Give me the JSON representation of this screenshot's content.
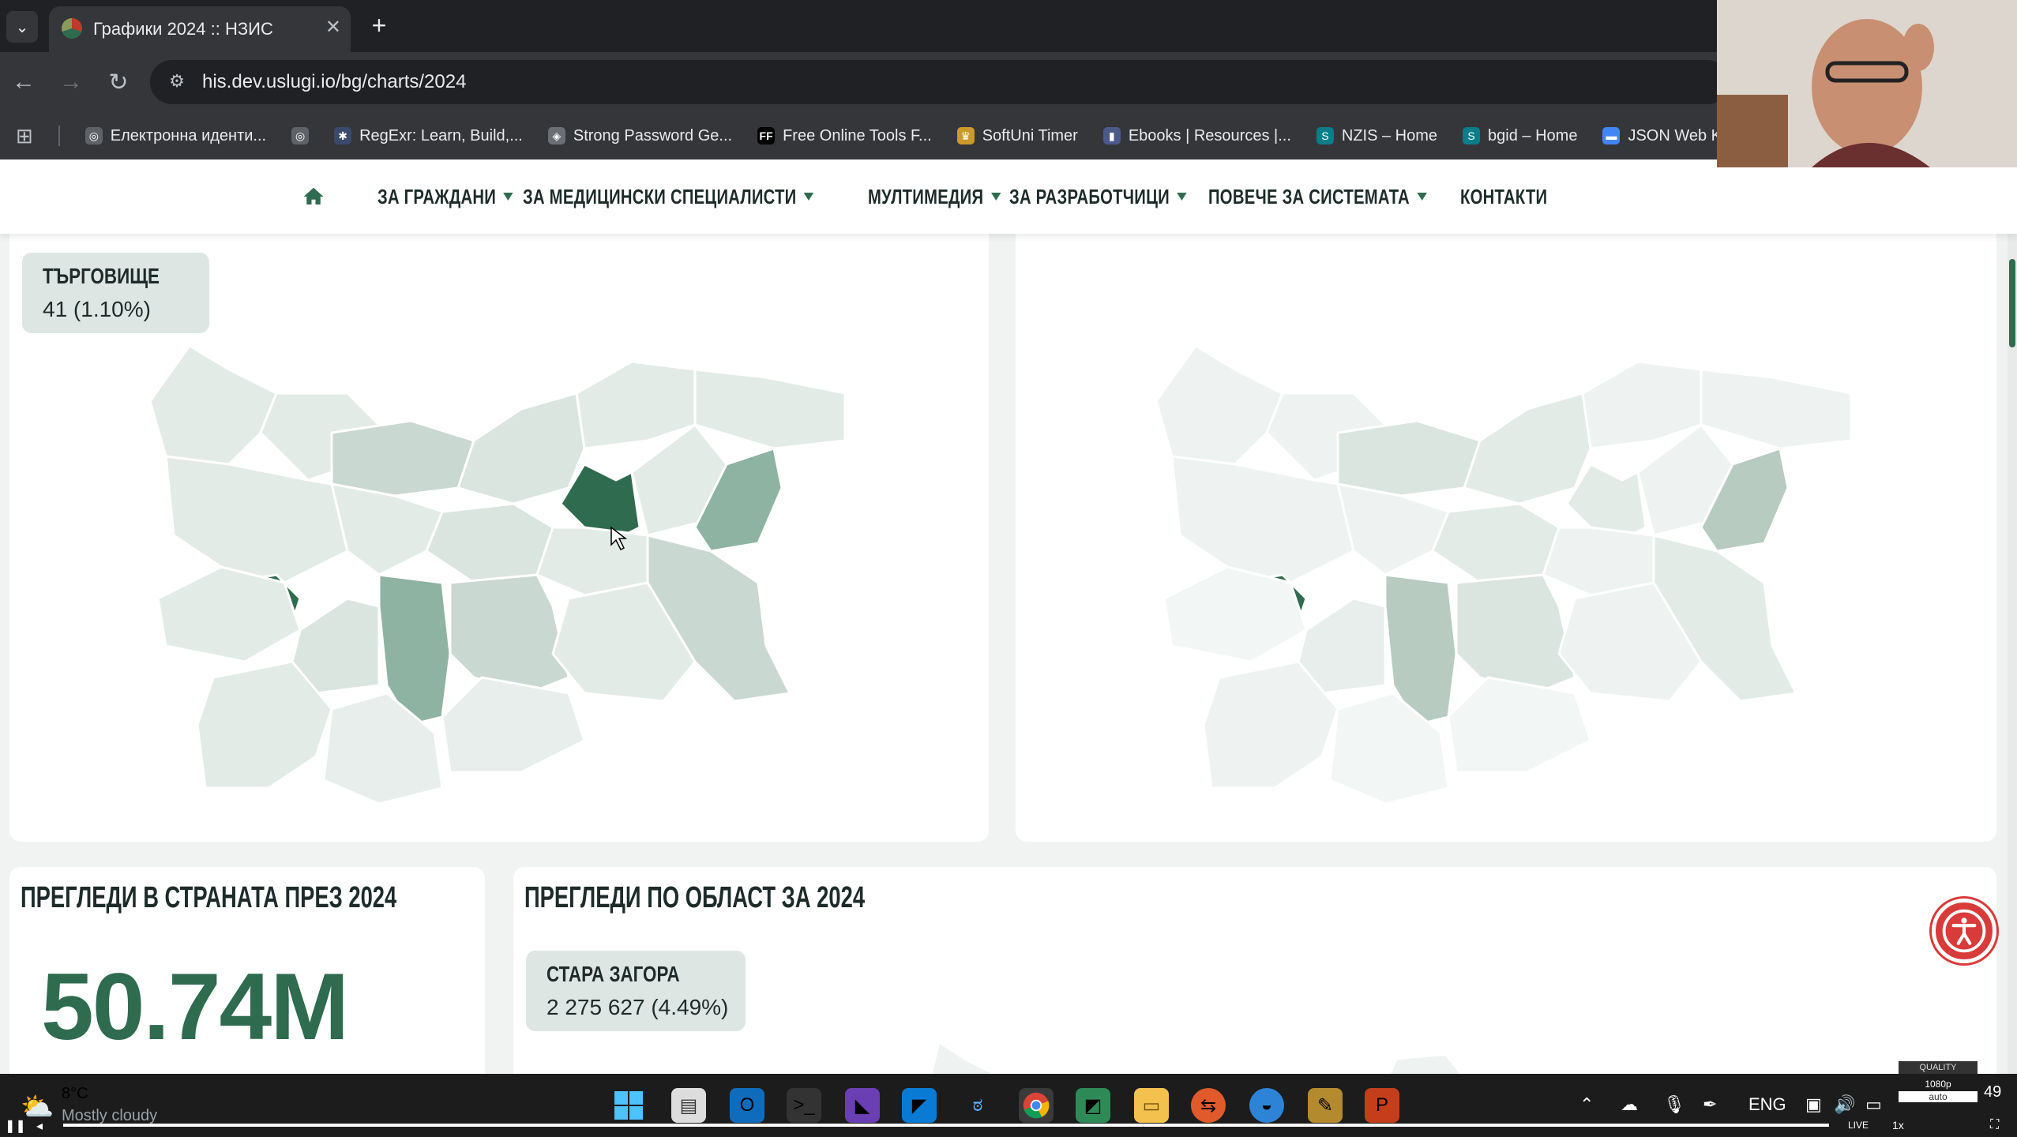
{
  "browser": {
    "tab_title": "Графики 2024 :: НЗИС",
    "url": "his.dev.uslugi.io/bg/charts/2024",
    "bookmarks": [
      {
        "label": "Електронна иденти...",
        "icon": "globe-icon"
      },
      {
        "label": "",
        "icon": "globe-icon"
      },
      {
        "label": "RegExr: Learn, Build,...",
        "icon": "regexr-icon"
      },
      {
        "label": "Strong Password Ge...",
        "icon": "shield-icon"
      },
      {
        "label": "Free Online Tools F...",
        "icon": "ff-icon"
      },
      {
        "label": "SoftUni Timer",
        "icon": "softuni-icon"
      },
      {
        "label": "Ebooks | Resources |...",
        "icon": "ebooks-icon"
      },
      {
        "label": "NZIS – Home",
        "icon": "sharepoint-icon"
      },
      {
        "label": "bgid – Home",
        "icon": "sharepoint-icon"
      },
      {
        "label": "JSON Web Key (JW",
        "icon": "jwk-icon"
      }
    ]
  },
  "nav": {
    "items": [
      {
        "label": "ЗА ГРАЖДАНИ",
        "dropdown": true
      },
      {
        "label": "ЗА МЕДИЦИНСКИ СПЕЦИАЛИСТИ",
        "dropdown": true
      },
      {
        "label": "МУЛТИМЕДИЯ",
        "dropdown": true
      },
      {
        "label": "ЗА РАЗРАБОТЧИЦИ",
        "dropdown": true
      },
      {
        "label": "ПОВЕЧЕ ЗА СИСТЕМАТА",
        "dropdown": true
      },
      {
        "label": "КОНТАКТИ",
        "dropdown": false
      }
    ]
  },
  "map_left": {
    "tooltip_region": "ТЪРГОВИЩЕ",
    "tooltip_value": "41 (1.10%)"
  },
  "stat_card": {
    "title": "ПРЕГЛЕДИ В СТРАНАТА ПРЕЗ 2024",
    "value": "50.74M"
  },
  "region_card": {
    "title": "ПРЕГЛЕДИ ПО ОБЛАСТ ЗА 2024",
    "tooltip_region": "СТАРА ЗАГОРА",
    "tooltip_value": "2 275 627 (4.49%)"
  },
  "colors": {
    "brand_dark": "#2e6b4f",
    "mid": "#8fb3a2",
    "light": "#c9d8d1",
    "lightest": "#e3ebe7"
  },
  "taskbar": {
    "weather_temp": "8°C",
    "weather_desc": "Mostly cloudy",
    "lang": "ENG",
    "quality_label": "QUALITY",
    "quality_value": "1080p",
    "quality_mode": "auto",
    "live_label": "LIVE",
    "speed": "1x",
    "clock": "49"
  }
}
